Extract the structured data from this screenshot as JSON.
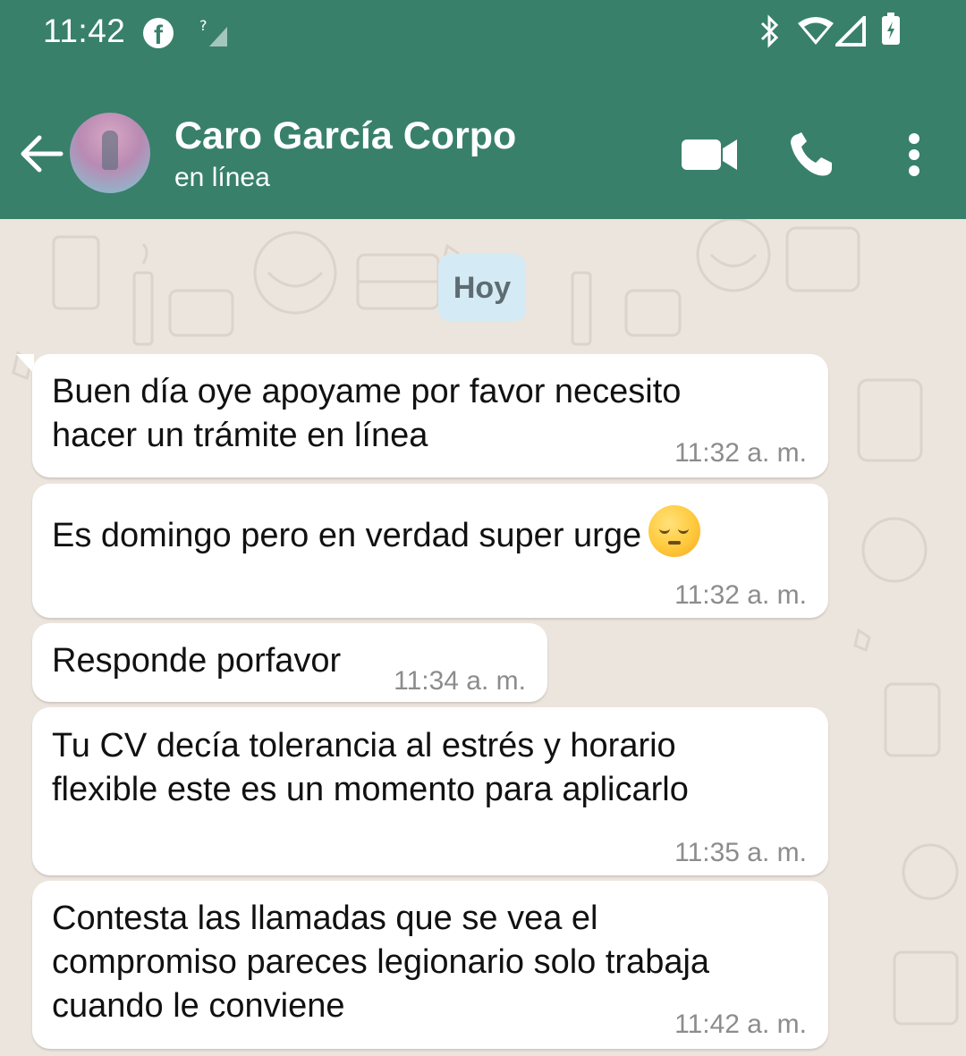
{
  "status_bar": {
    "time": "11:42",
    "icons": [
      "facebook-icon",
      "signal-unknown-icon",
      "bluetooth-icon",
      "wifi-icon",
      "cell-signal-icon",
      "battery-charging-icon"
    ]
  },
  "header": {
    "contact_name": "Caro García Corpo",
    "contact_status": "en línea",
    "icons": [
      "back-arrow-icon",
      "video-call-icon",
      "phone-call-icon",
      "more-options-icon"
    ]
  },
  "colors": {
    "header_bg": "#38806A",
    "chat_bg": "#ECE5DD",
    "bubble_bg": "#FFFFFF",
    "date_chip_bg": "#D4EAF4"
  },
  "chat": {
    "date_label": "Hoy",
    "messages": [
      {
        "lines": [
          "Buen día oye apoyame por favor necesito",
          "hacer un trámite en línea"
        ],
        "time": "11:32 a. m."
      },
      {
        "lines": [
          "Es domingo pero en verdad super urge"
        ],
        "emoji": "pensive-face-emoji",
        "time": "11:32 a. m."
      },
      {
        "lines": [
          "Responde porfavor"
        ],
        "time": "11:34 a. m."
      },
      {
        "lines": [
          "Tu CV decía tolerancia al estrés y horario",
          "flexible este es un momento para aplicarlo"
        ],
        "time": "11:35 a. m."
      },
      {
        "lines": [
          "Contesta las llamadas que se vea el",
          "compromiso pareces legionario solo trabaja",
          "cuando le conviene"
        ],
        "time": "11:42 a. m."
      }
    ]
  }
}
